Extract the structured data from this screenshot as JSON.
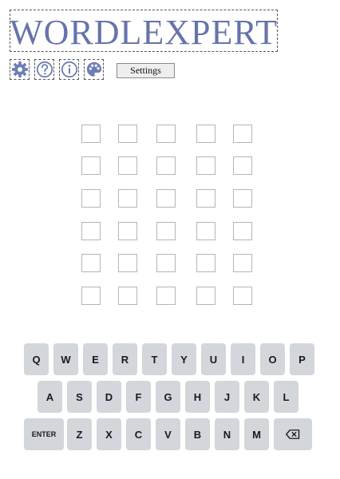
{
  "header": {
    "logo_text": "WORDLEXPERT"
  },
  "toolbar": {
    "icons": [
      "gear-icon",
      "help-icon",
      "info-icon",
      "palette-icon"
    ],
    "settings_label": "Settings"
  },
  "board": {
    "rows": 6,
    "cols": 5
  },
  "keyboard": {
    "row1": [
      "Q",
      "W",
      "E",
      "R",
      "T",
      "Y",
      "U",
      "I",
      "O",
      "P"
    ],
    "row2": [
      "A",
      "S",
      "D",
      "F",
      "G",
      "H",
      "J",
      "K",
      "L"
    ],
    "row3": [
      "ENTER",
      "Z",
      "X",
      "C",
      "V",
      "B",
      "N",
      "M",
      "backspace"
    ]
  },
  "colors": {
    "logo": "#6674aa",
    "icon": "#6f7fb5",
    "key_bg": "#d3d6da",
    "cell_border": "#b5b5b5"
  }
}
